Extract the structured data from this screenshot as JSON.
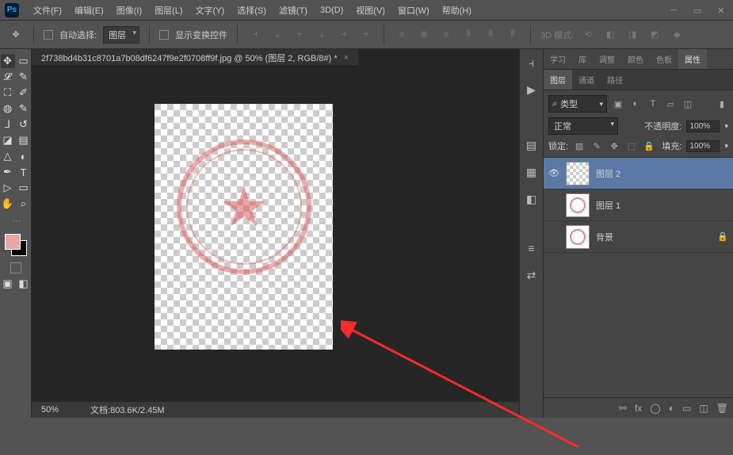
{
  "menu": {
    "file": "文件(F)",
    "edit": "编辑(E)",
    "image": "图像(I)",
    "layer": "图层(L)",
    "type": "文字(Y)",
    "select": "选择(S)",
    "filter": "滤镜(T)",
    "threeD": "3D(D)",
    "view": "视图(V)",
    "window": "窗口(W)",
    "help": "帮助(H)"
  },
  "optbar": {
    "autoSelect": "自动选择:",
    "layerDD": "图层",
    "showTransform": "显示变换控件",
    "mode3d": "3D 模式:"
  },
  "tab": {
    "title": "2f738bd4b31c8701a7b08df6247f9e2f0708ff9f.jpg @ 50% (图层 2, RGB/8#) *"
  },
  "status": {
    "zoom": "50%",
    "doc": "文档:803.6K/2.45M"
  },
  "rtabs1": {
    "learn": "学习",
    "lib": "库",
    "adjust": "调整",
    "color": "颜色",
    "swatch": "色板",
    "props": "属性"
  },
  "rtabs2": {
    "layers": "图层",
    "channels": "通道",
    "paths": "路径"
  },
  "layerPanel": {
    "filterLabel": "类型",
    "searchIcon": "⌕",
    "blend": "正常",
    "opacityLabel": "不透明度:",
    "opacity": "100%",
    "lockLabel": "锁定:",
    "fillLabel": "填充:",
    "fill": "100%"
  },
  "layers": [
    {
      "name": "图层 2",
      "visible": true,
      "selected": true,
      "thumb": "checker"
    },
    {
      "name": "图层 1",
      "visible": false,
      "selected": false,
      "thumb": "img"
    },
    {
      "name": "背景",
      "visible": false,
      "selected": false,
      "thumb": "img",
      "locked": true
    }
  ]
}
